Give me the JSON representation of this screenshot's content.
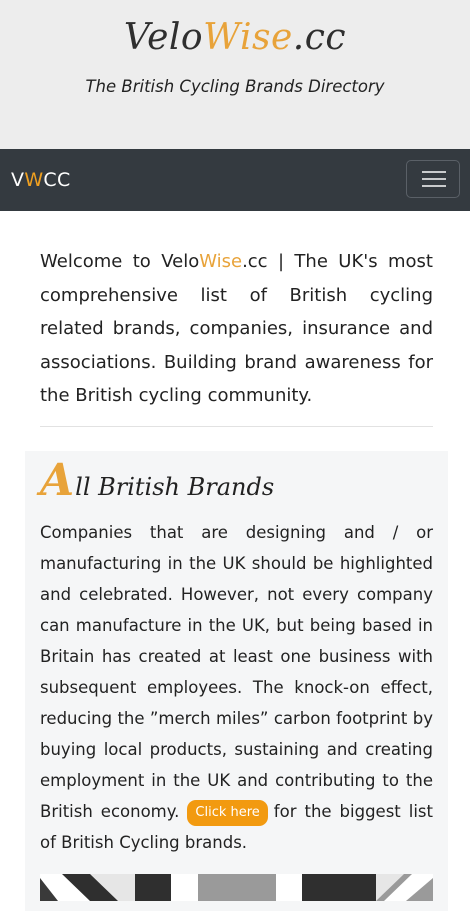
{
  "header": {
    "title_part1": "Velo",
    "title_accent": "Wise",
    "title_part2": ".cc",
    "tagline": "The British Cycling Brands Directory"
  },
  "navbar": {
    "brand_v": "V",
    "brand_w": "W",
    "brand_cc": "CC",
    "menu_icon": "hamburger-icon"
  },
  "intro": {
    "text_before": "Welcome to Velo",
    "text_accent": "Wise",
    "text_after": ".cc | The UK's most comprehensive list of British cycling related brands, companies, insurance and associations. Building brand awareness for the British cycling community."
  },
  "card": {
    "dropcap": "A",
    "title_rest": "ll British Brands",
    "body": "Companies that are designing and / or manufacturing in the UK should be highlighted and celebrated. However, not every company can manufacture in the UK, but being based in Britain has created at least one business with subsequent employees. The knock-on effect, reducing the ”merch miles” carbon footprint by buying local products, sustaining and creating employment in the UK and contributing to the British economy.",
    "button_label": "Click here",
    "button_suffix": "for the biggest list of British Cycling brands."
  },
  "colors": {
    "accent": "#e8a33a",
    "button": "#f29a10",
    "navbar": "#343a40",
    "header_bg": "#ededed"
  }
}
